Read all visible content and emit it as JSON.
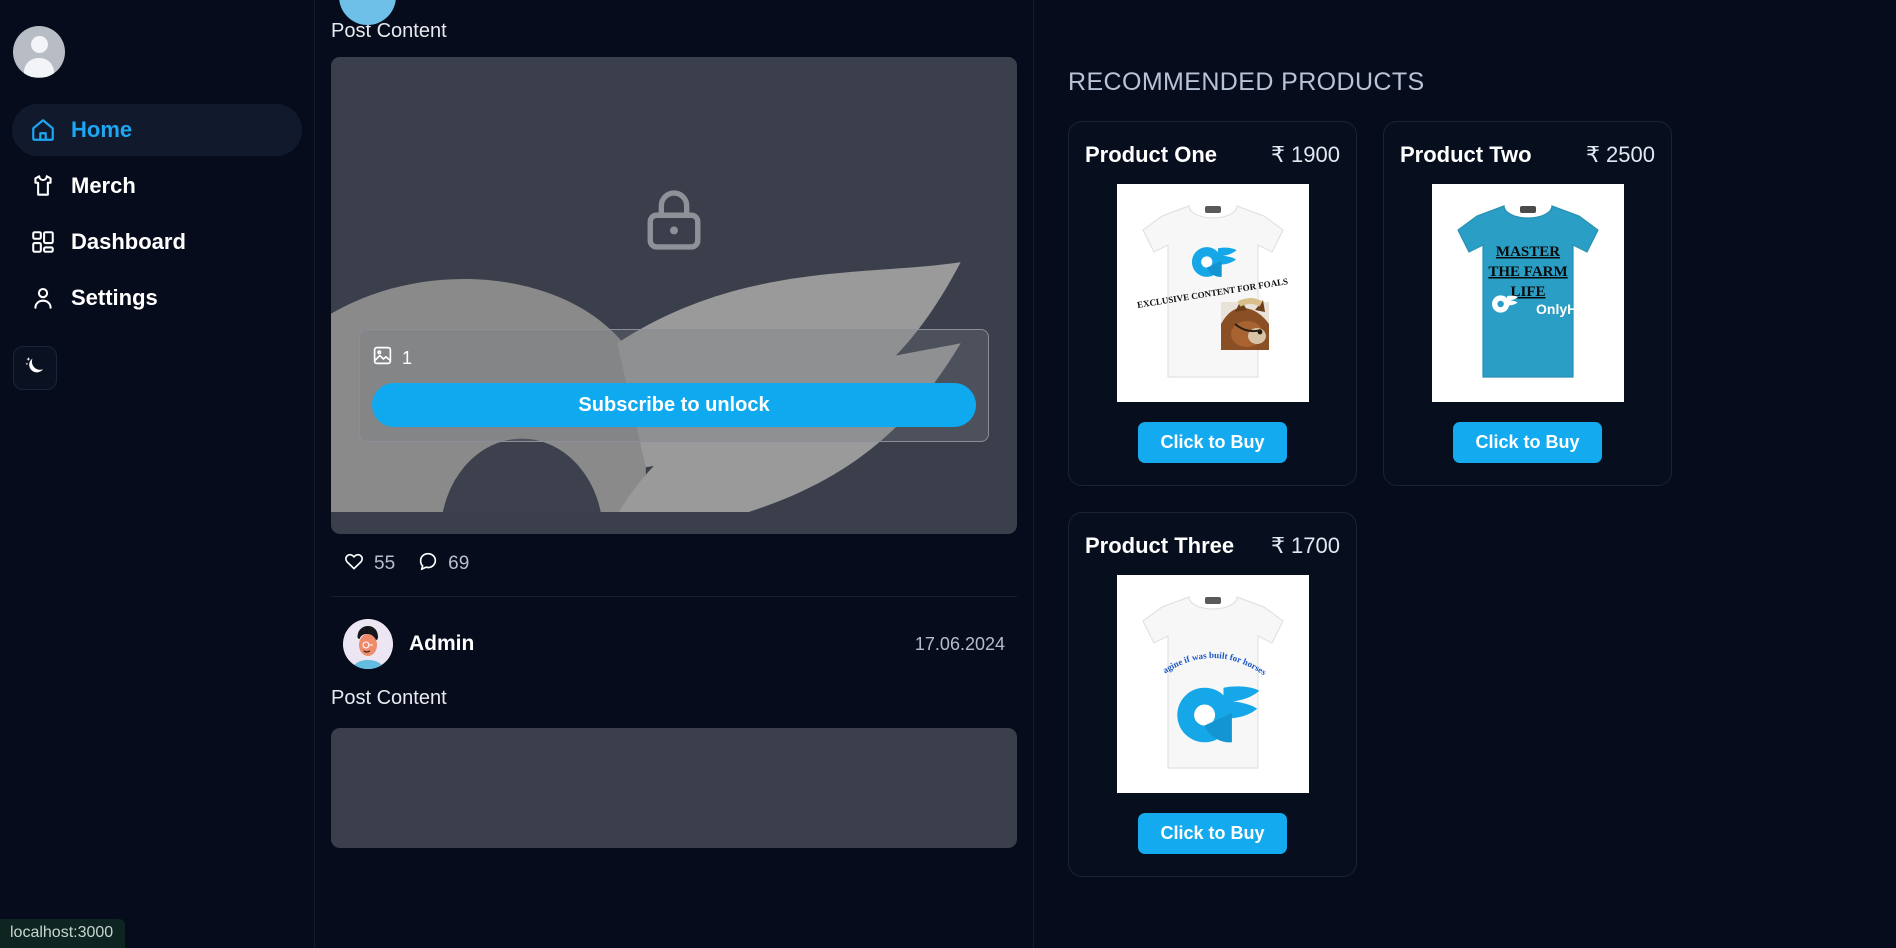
{
  "sidebar": {
    "avatar_name": "user-avatar",
    "items": [
      {
        "label": "Home",
        "icon": "home-icon",
        "active": true
      },
      {
        "label": "Merch",
        "icon": "tshirt-icon",
        "active": false
      },
      {
        "label": "Dashboard",
        "icon": "dashboard-grid-icon",
        "active": false
      },
      {
        "label": "Settings",
        "icon": "person-icon",
        "active": false
      }
    ],
    "theme_toggle_icon": "moon-stars-icon"
  },
  "status_bar": {
    "url": "localhost:3000"
  },
  "feed": {
    "posts": [
      {
        "content_label": "Post Content",
        "locked": true,
        "lock_icon": "lock-icon",
        "image_count_icon": "image-icon",
        "image_count": "1",
        "subscribe_label": "Subscribe to unlock",
        "likes_icon": "heart-icon",
        "likes": "55",
        "comments_icon": "comment-icon",
        "comments": "69"
      },
      {
        "author": "Admin",
        "date": "17.06.2024",
        "content_label": "Post Content"
      }
    ]
  },
  "recommended": {
    "title": "RECOMMENDED PRODUCTS",
    "buy_label": "Click to Buy",
    "currency": "₹",
    "products": [
      {
        "name": "Product One",
        "price": "₹ 1900",
        "shirt_color": "#ffffff",
        "graphic": "of-logo-horse",
        "caption": "EXCLUSIVE CONTENT FOR FOALS"
      },
      {
        "name": "Product Two",
        "price": "₹ 2500",
        "shirt_color": "#2a9ec4",
        "graphic": "master-the-farm-life",
        "line1": "MASTER",
        "line2": "THE FARM",
        "line3": "LIFE",
        "brand": "OnlyHorse"
      },
      {
        "name": "Product Three",
        "price": "₹ 1700",
        "shirt_color": "#ffffff",
        "graphic": "of-logo-big",
        "caption": "imagine if was built for horses..."
      }
    ]
  },
  "colors": {
    "accent": "#0fa9f0",
    "background": "#060c1b",
    "panel": "#3a3f4b",
    "sidebar_active_text": "#1da6f2"
  }
}
